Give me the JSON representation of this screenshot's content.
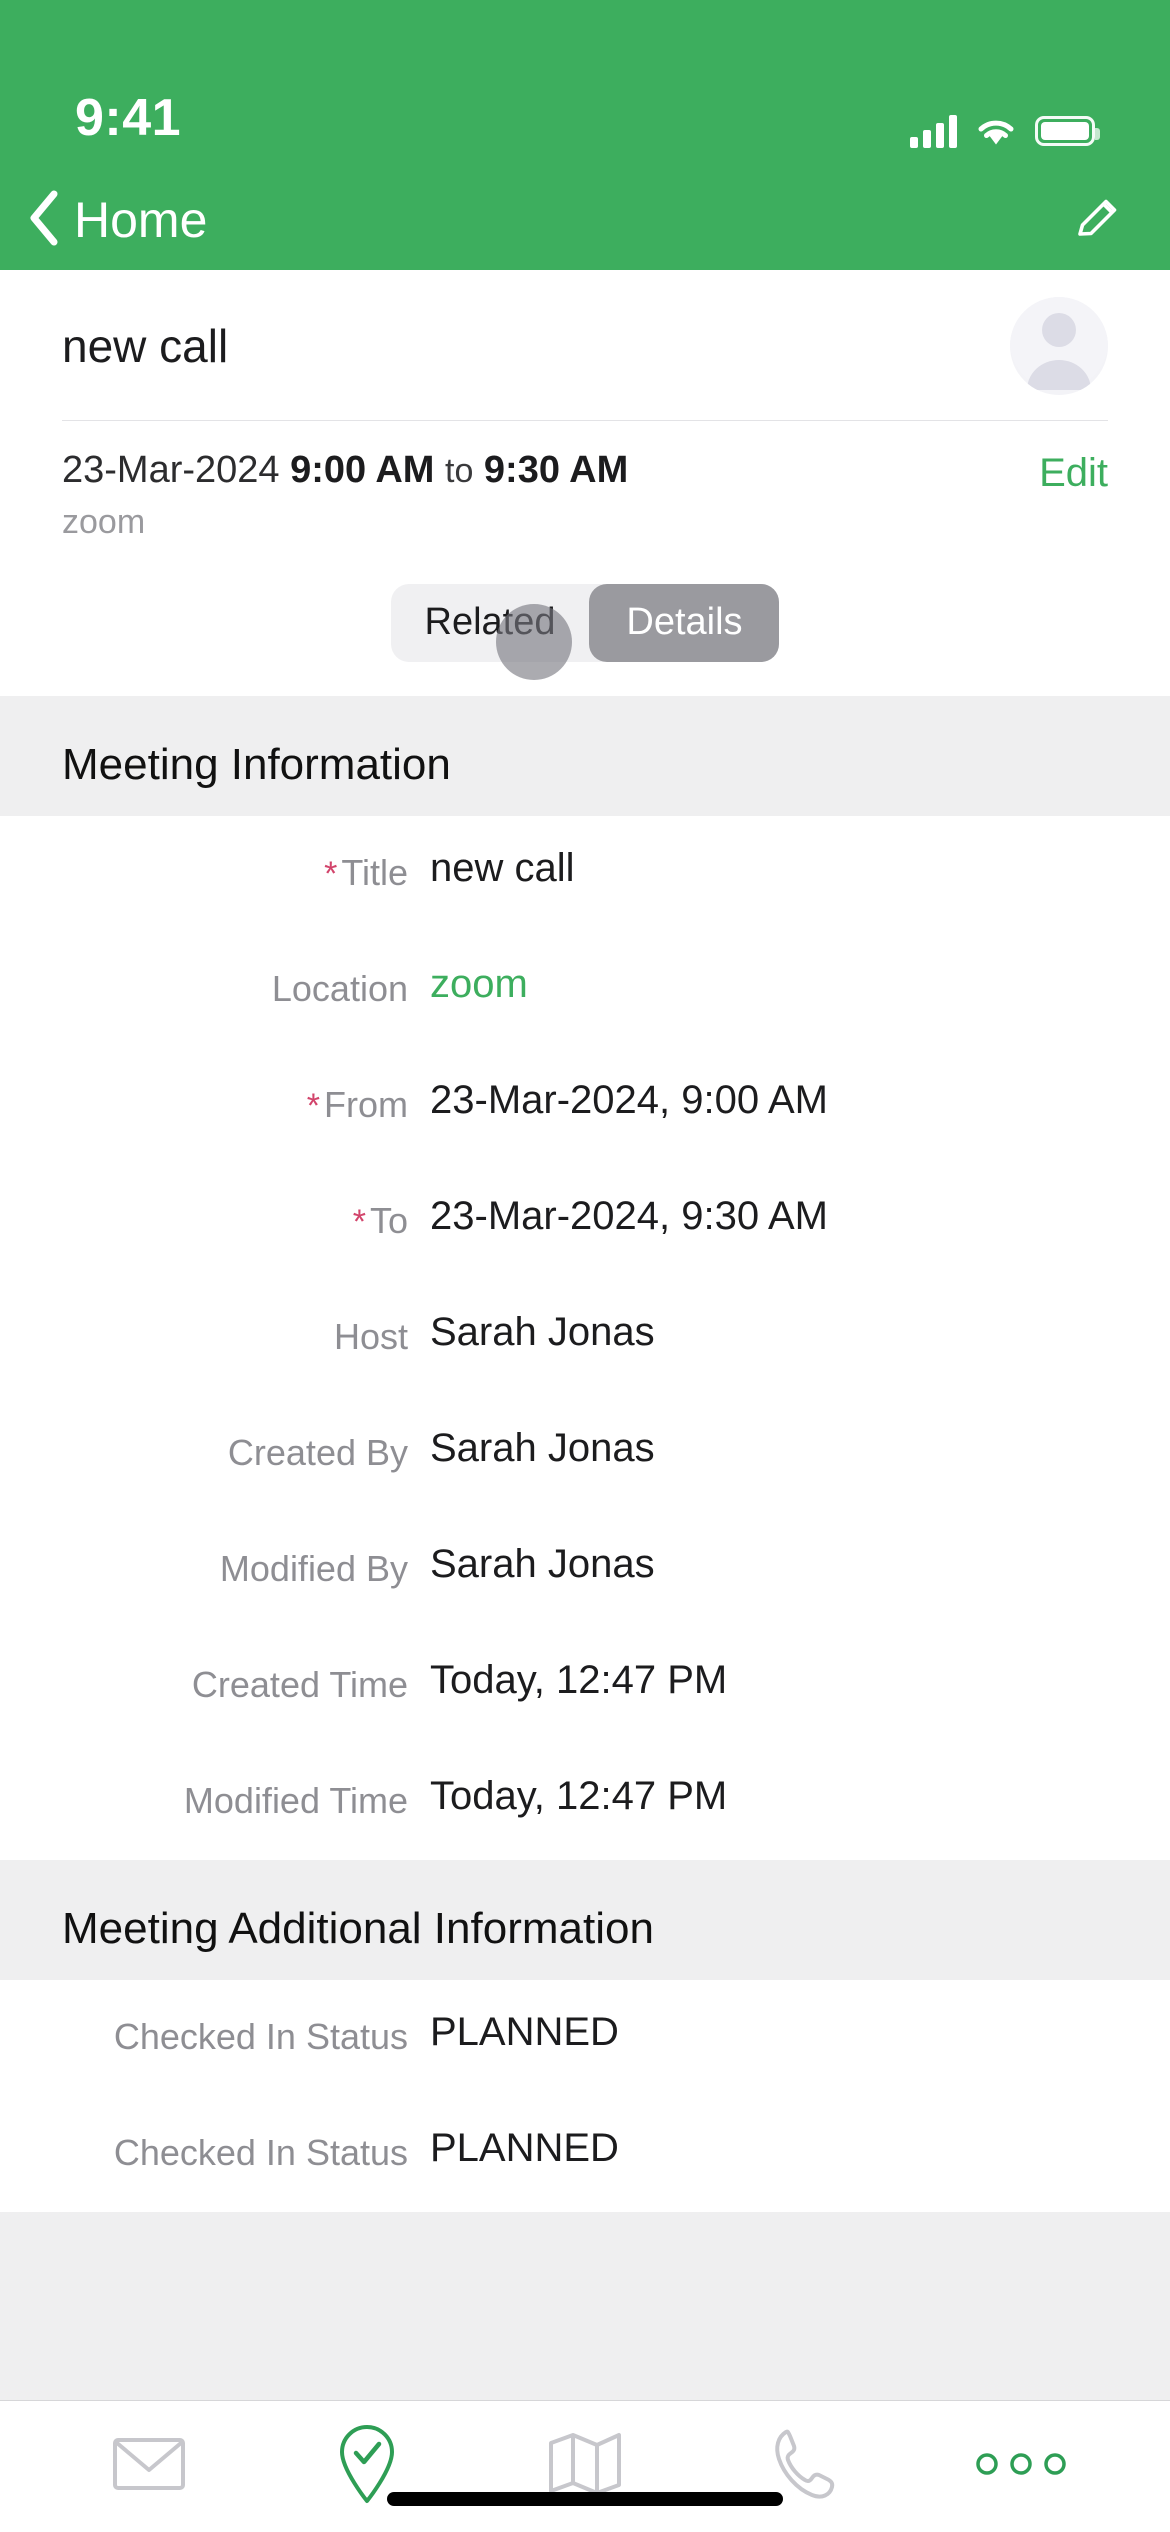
{
  "theme": {
    "brand_green": "#3DAE5E",
    "required_red": "#d2446b",
    "label_gray": "#8e8e93",
    "page_bg": "#efeff0"
  },
  "status_bar": {
    "time": "9:41",
    "signal_icon": "cellular-bars-icon",
    "wifi_icon": "wifi-icon",
    "battery_icon": "battery-icon"
  },
  "nav": {
    "back_label": "Home",
    "back_icon": "chevron-left-icon",
    "edit_icon": "pencil-edit-icon"
  },
  "record": {
    "title": "new call",
    "avatar_icon": "user-avatar-placeholder-icon",
    "date": "23-Mar-2024",
    "start_time": "9:00 AM",
    "separator": "to",
    "end_time": "9:30 AM",
    "location": "zoom",
    "edit_label": "Edit"
  },
  "tabs": {
    "items": [
      {
        "label": "Related",
        "active": false
      },
      {
        "label": "Details",
        "active": true
      }
    ]
  },
  "sections": [
    {
      "title": "Meeting Information",
      "rows": [
        {
          "label": "Title",
          "value": "new call",
          "required": true,
          "link": false
        },
        {
          "label": "Location",
          "value": "zoom",
          "required": false,
          "link": true
        },
        {
          "label": "From",
          "value": "23-Mar-2024, 9:00 AM",
          "required": true,
          "link": false
        },
        {
          "label": "To",
          "value": "23-Mar-2024, 9:30 AM",
          "required": true,
          "link": false
        },
        {
          "label": "Host",
          "value": "Sarah Jonas",
          "required": false,
          "link": false
        },
        {
          "label": "Created By",
          "value": "Sarah Jonas",
          "required": false,
          "link": false
        },
        {
          "label": "Modified By",
          "value": "Sarah Jonas",
          "required": false,
          "link": false
        },
        {
          "label": "Created Time",
          "value": "Today, 12:47 PM",
          "required": false,
          "link": false
        },
        {
          "label": "Modified Time",
          "value": "Today, 12:47 PM",
          "required": false,
          "link": false
        }
      ]
    },
    {
      "title": "Meeting Additional Information",
      "rows": [
        {
          "label": "Checked In Status",
          "value": "PLANNED",
          "required": false,
          "link": false
        },
        {
          "label": "Checked In Status",
          "value": "PLANNED",
          "required": false,
          "link": false
        }
      ]
    }
  ],
  "toolbar": {
    "items": [
      {
        "icon": "email-envelope-icon",
        "active": false
      },
      {
        "icon": "check-in-location-pin-icon",
        "active": true
      },
      {
        "icon": "map-icon",
        "active": false
      },
      {
        "icon": "phone-call-icon",
        "active": false
      },
      {
        "icon": "more-options-icon",
        "active": true
      }
    ]
  }
}
